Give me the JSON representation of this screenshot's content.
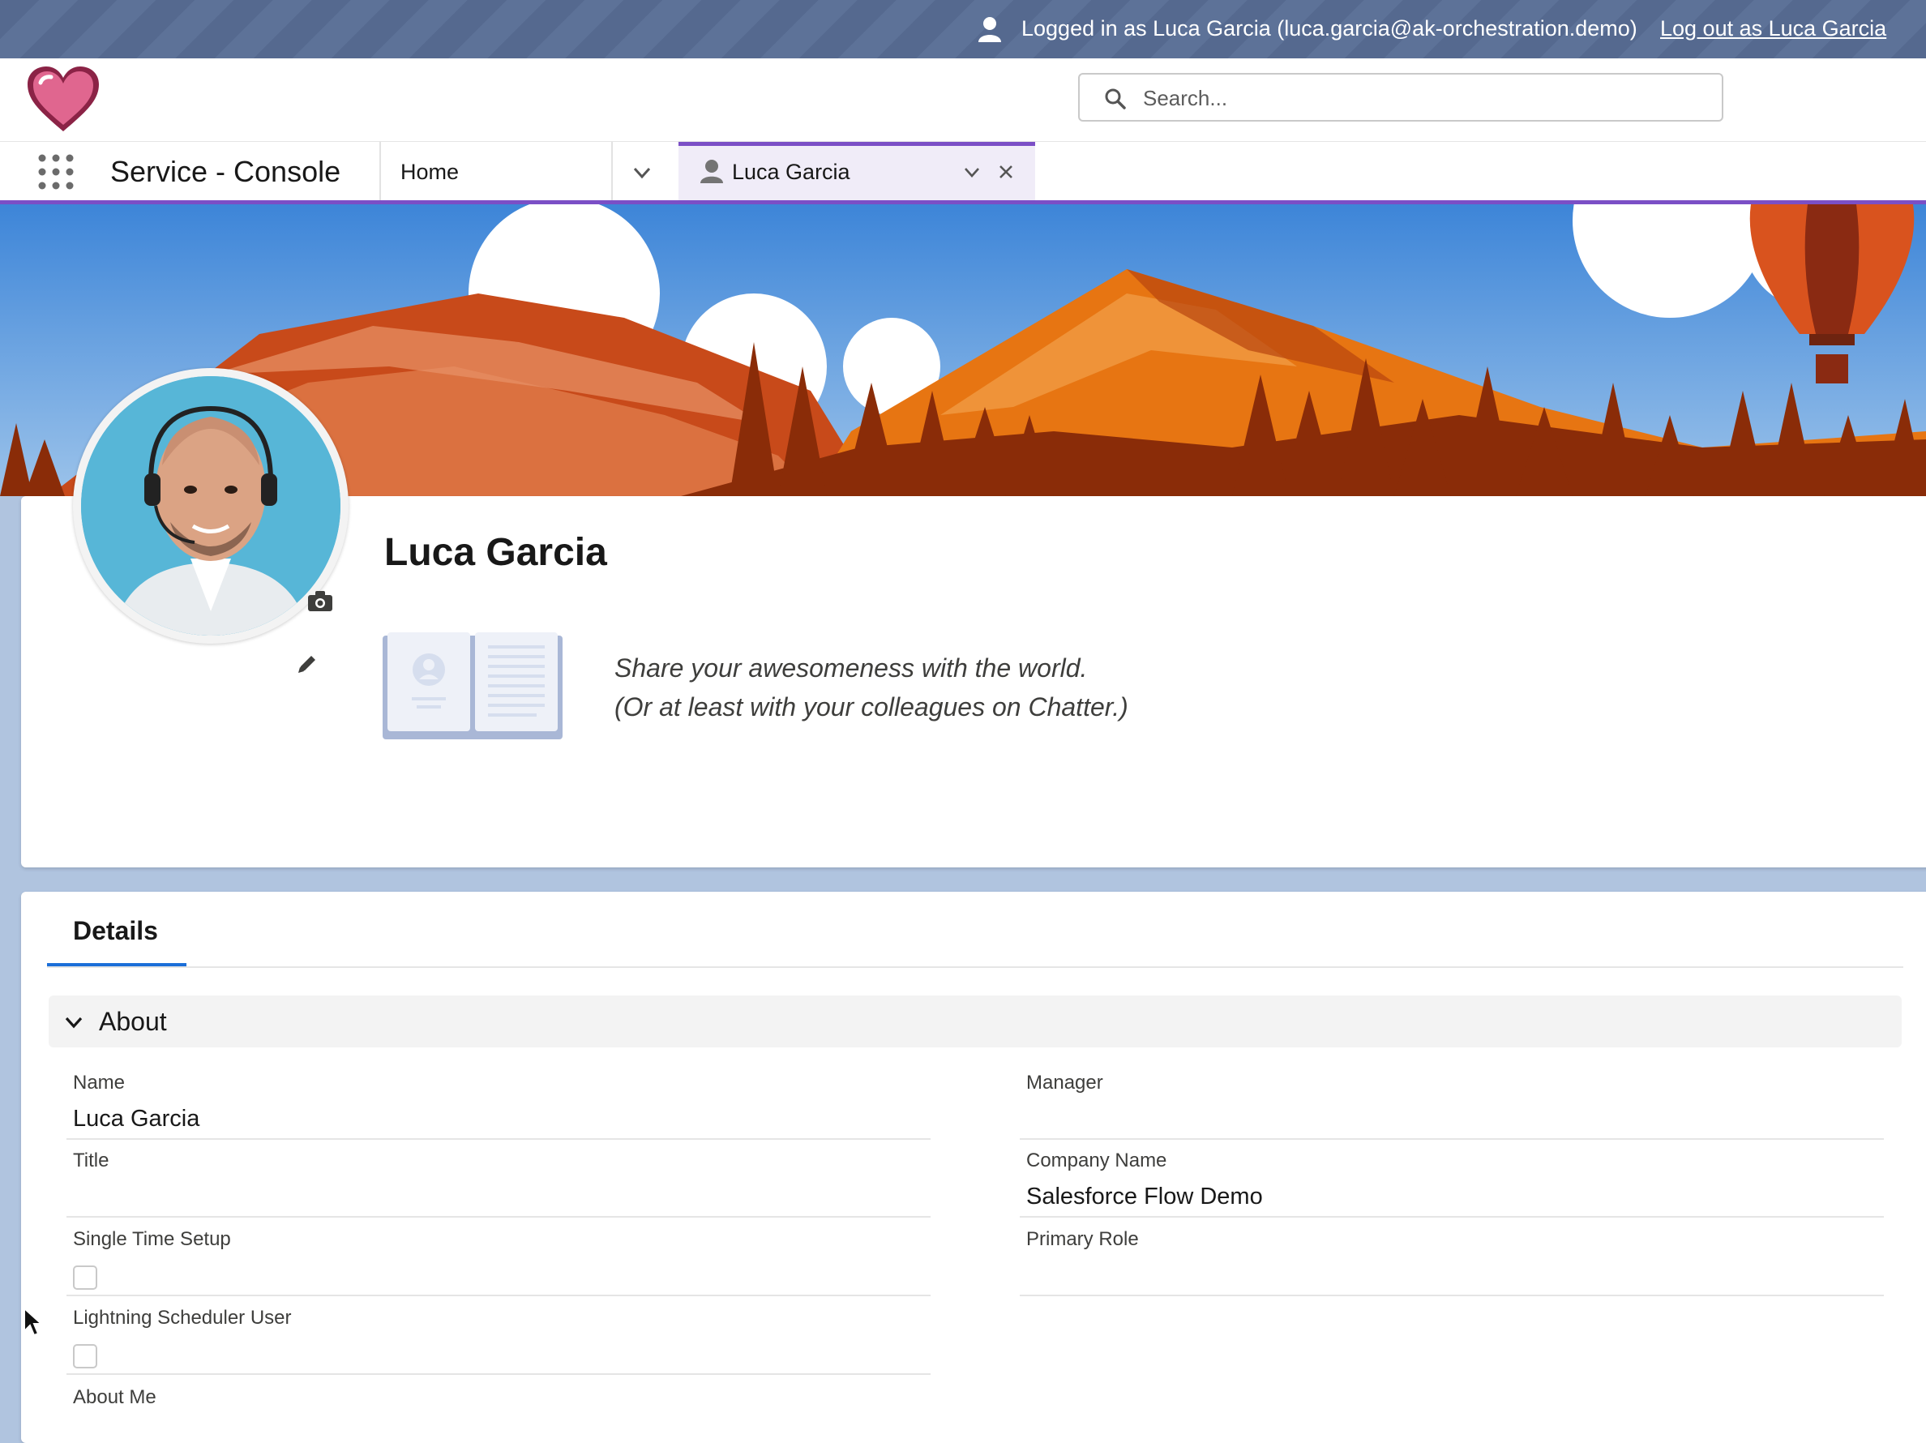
{
  "topbar": {
    "logged_in_text": "Logged in as Luca Garcia (luca.garcia@ak-orchestration.demo)",
    "logout_link": "Log out as Luca Garcia"
  },
  "header": {
    "search_placeholder": "Search..."
  },
  "nav": {
    "app_name": "Service - Console",
    "home_tab": "Home",
    "active_tab": "Luca Garcia"
  },
  "profile": {
    "name": "Luca Garcia",
    "share_line1": "Share your awesomeness with the world.",
    "share_line2": "(Or at least with your colleagues on Chatter.)"
  },
  "details": {
    "tab_label": "Details",
    "section_title": "About",
    "fields": {
      "name_label": "Name",
      "name_value": "Luca Garcia",
      "manager_label": "Manager",
      "manager_value": "",
      "title_label": "Title",
      "title_value": "",
      "company_label": "Company Name",
      "company_value": "Salesforce Flow Demo",
      "single_time_setup_label": "Single Time Setup",
      "single_time_setup_checked": false,
      "primary_role_label": "Primary Role",
      "primary_role_value": "",
      "lightning_scheduler_label": "Lightning Scheduler User",
      "lightning_scheduler_checked": false,
      "about_me_label": "About Me"
    }
  },
  "colors": {
    "accent_purple": "#7b4fc6",
    "tab_underline_blue": "#1b6ed8",
    "topbar_bg": "#5a6e94"
  },
  "icons": [
    "user-icon",
    "heart-logo",
    "search-icon",
    "app-launcher-icon",
    "chevron-down-icon",
    "close-icon",
    "camera-icon",
    "pencil-icon",
    "book-icon"
  ]
}
